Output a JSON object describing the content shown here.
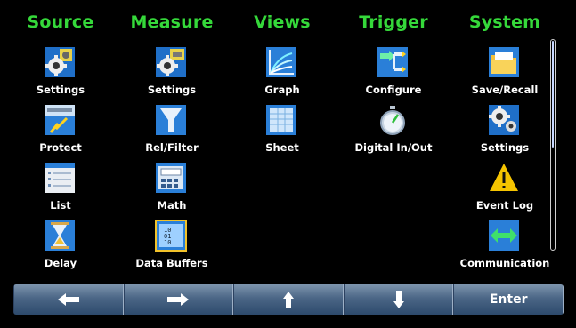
{
  "columns": [
    {
      "title": "Source",
      "items": [
        {
          "label": "Settings",
          "icon": "source-settings-icon"
        },
        {
          "label": "Protect",
          "icon": "protect-icon"
        },
        {
          "label": "List",
          "icon": "list-icon"
        },
        {
          "label": "Delay",
          "icon": "hourglass-icon"
        }
      ]
    },
    {
      "title": "Measure",
      "items": [
        {
          "label": "Settings",
          "icon": "measure-settings-icon"
        },
        {
          "label": "Rel/Filter",
          "icon": "filter-icon"
        },
        {
          "label": "Math",
          "icon": "calculator-icon"
        },
        {
          "label": "Data Buffers",
          "icon": "data-buffers-icon",
          "selected": true
        }
      ]
    },
    {
      "title": "Views",
      "items": [
        {
          "label": "Graph",
          "icon": "graph-icon"
        },
        {
          "label": "Sheet",
          "icon": "sheet-icon"
        }
      ]
    },
    {
      "title": "Trigger",
      "items": [
        {
          "label": "Configure",
          "icon": "trigger-configure-icon"
        },
        {
          "label": "Digital In/Out",
          "icon": "stopwatch-icon"
        }
      ]
    },
    {
      "title": "System",
      "items": [
        {
          "label": "Save/Recall",
          "icon": "folder-icon"
        },
        {
          "label": "Settings",
          "icon": "system-settings-icon"
        },
        {
          "label": "Event Log",
          "icon": "warning-icon"
        },
        {
          "label": "Communication",
          "icon": "double-arrow-icon"
        }
      ]
    }
  ],
  "navbar": {
    "buttons": [
      {
        "icon": "arrow-left-icon"
      },
      {
        "icon": "arrow-right-icon"
      },
      {
        "icon": "arrow-up-icon"
      },
      {
        "icon": "arrow-down-icon"
      },
      {
        "label": "Enter"
      }
    ]
  },
  "colors": {
    "heading": "#35d83a",
    "nav": "#4b6686",
    "selection": "#f2c22a"
  }
}
